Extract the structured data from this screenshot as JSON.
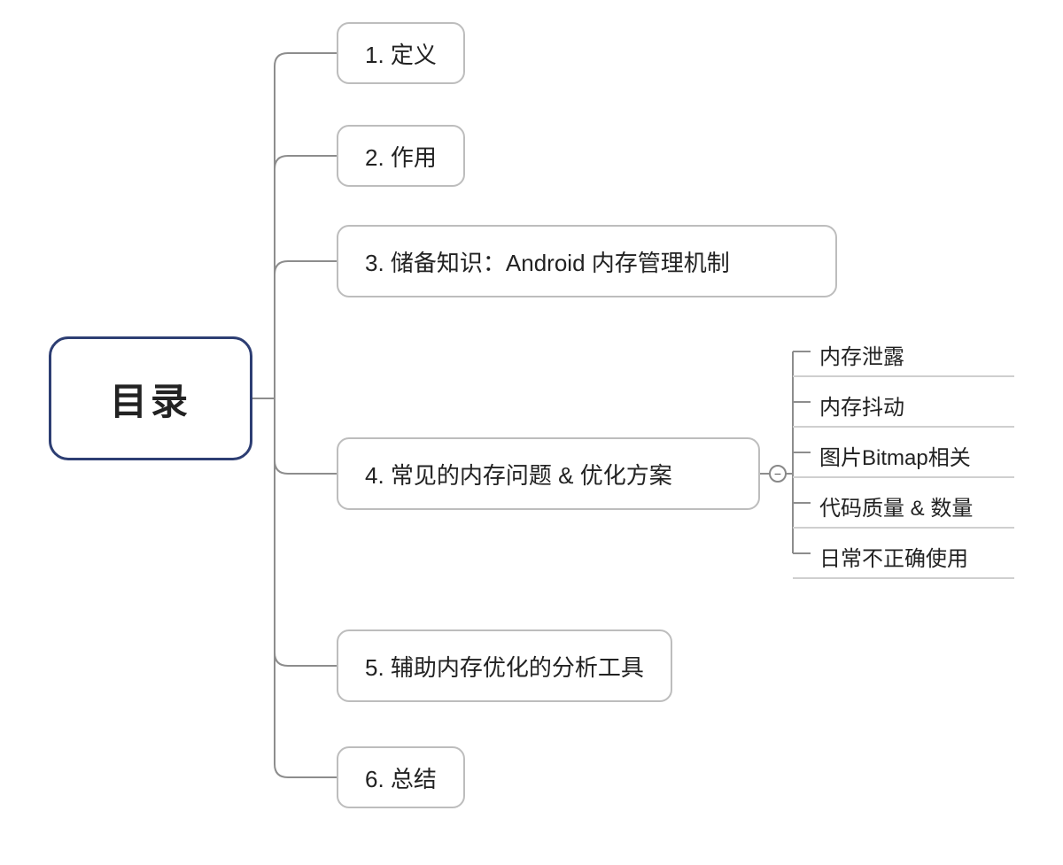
{
  "root": {
    "label": "目录"
  },
  "children": [
    {
      "label": "1. 定义"
    },
    {
      "label": "2. 作用"
    },
    {
      "label": "3. 储备知识：Android 内存管理机制"
    },
    {
      "label": "4. 常见的内存问题 & 优化方案",
      "subchildren": [
        {
          "label": "内存泄露"
        },
        {
          "label": "内存抖动"
        },
        {
          "label": "图片Bitmap相关"
        },
        {
          "label": "代码质量 & 数量"
        },
        {
          "label": "日常不正确使用"
        }
      ]
    },
    {
      "label": "5. 辅助内存优化的分析工具"
    },
    {
      "label": "6. 总结"
    }
  ],
  "toggle_glyph": "−"
}
